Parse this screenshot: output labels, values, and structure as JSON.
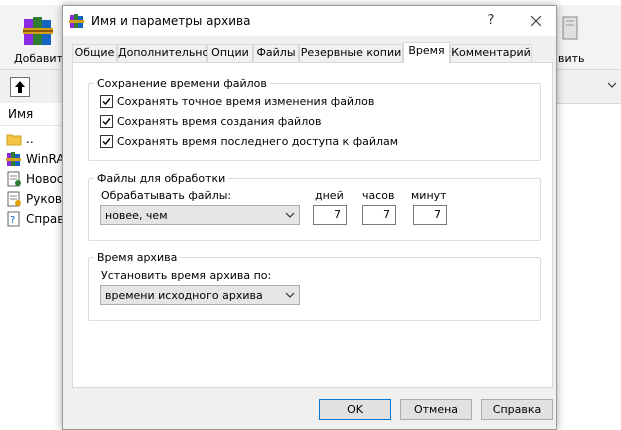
{
  "background_window": {
    "toolbar": {
      "add_label": "Добавить",
      "extract_label": "вить"
    },
    "file_list": {
      "column_name": "Имя",
      "rows": [
        {
          "name": "..",
          "icon": "folder-icon"
        },
        {
          "name": "WinRAR",
          "icon": "winrar-archive-icon"
        },
        {
          "name": "Новост",
          "icon": "text-file-icon"
        },
        {
          "name": "Руково",
          "icon": "text-file-icon"
        },
        {
          "name": "Справк",
          "icon": "help-file-icon"
        }
      ]
    }
  },
  "dialog": {
    "title": "Имя и параметры архива",
    "help_glyph": "?",
    "tabs": [
      {
        "label": "Общие"
      },
      {
        "label": "Дополнительно"
      },
      {
        "label": "Опции"
      },
      {
        "label": "Файлы"
      },
      {
        "label": "Резервные копии"
      },
      {
        "label": "Время"
      },
      {
        "label": "Комментарий"
      }
    ],
    "active_tab": "Время",
    "file_time_group": {
      "legend": "Сохранение времени файлов",
      "options": [
        {
          "label": "Сохранять точное время изменения файлов",
          "checked": true
        },
        {
          "label": "Сохранять время создания файлов",
          "checked": true
        },
        {
          "label": "Сохранять время последнего доступа к файлам",
          "checked": true
        }
      ]
    },
    "files_to_process_group": {
      "legend": "Файлы для обработки",
      "process_label": "Обрабатывать файлы:",
      "process_value": "новее, чем",
      "days_label": "дней",
      "days_value": "7",
      "hours_label": "часов",
      "hours_value": "7",
      "minutes_label": "минут",
      "minutes_value": "7"
    },
    "archive_time_group": {
      "legend": "Время архива",
      "set_label": "Установить время архива по:",
      "set_value": "времени исходного архива"
    },
    "buttons": {
      "ok": "OK",
      "cancel": "Отмена",
      "help": "Справка"
    }
  },
  "colors": {
    "dialog_bg": "#f0f0f0",
    "panel_bg": "#ffffff",
    "default_button_border": "#0078d7",
    "button_bg": "#e1e1e1"
  }
}
